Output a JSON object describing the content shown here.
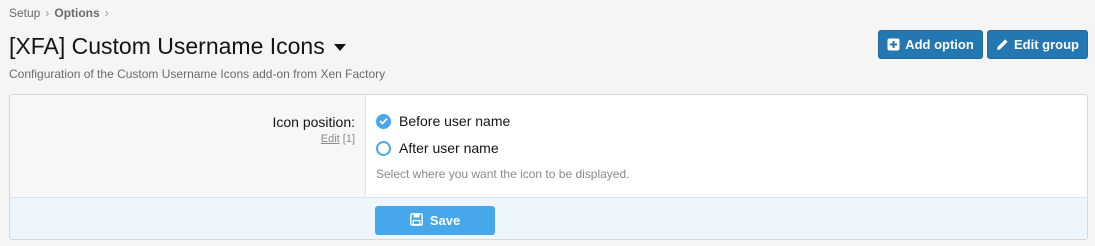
{
  "breadcrumb": {
    "items": [
      "Setup",
      "Options"
    ]
  },
  "header": {
    "title": "[XFA] Custom Username Icons",
    "subtitle": "Configuration of the Custom Username Icons add-on from Xen Factory"
  },
  "actions": {
    "add_option": "Add option",
    "edit_group": "Edit group"
  },
  "option": {
    "label": "Icon position:",
    "edit_link": "Edit",
    "display_order": "[1]",
    "choices": [
      {
        "label": "Before user name",
        "checked": true
      },
      {
        "label": "After user name",
        "checked": false
      }
    ],
    "hint": "Select where you want the icon to be displayed."
  },
  "footer": {
    "save_label": "Save"
  },
  "colors": {
    "primary": "#2577b1",
    "accent": "#47a7eb",
    "footer_bg": "#edf6fd"
  }
}
